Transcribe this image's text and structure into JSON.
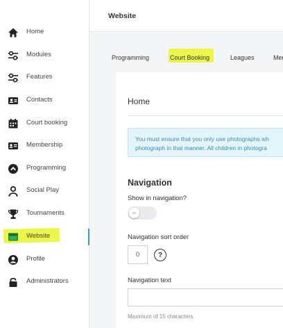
{
  "sidebar": {
    "items": [
      {
        "label": "Home",
        "icon": "home-icon"
      },
      {
        "label": "Modules",
        "icon": "sliders-icon"
      },
      {
        "label": "Features",
        "icon": "sliders-icon"
      },
      {
        "label": "Contacts",
        "icon": "contact-card-icon"
      },
      {
        "label": "Court booking",
        "icon": "calendar-icon"
      },
      {
        "label": "Membership",
        "icon": "id-card-icon"
      },
      {
        "label": "Programming",
        "icon": "chevron-circle-icon"
      },
      {
        "label": "Social Play",
        "icon": "user-group-icon"
      },
      {
        "label": "Tournaments",
        "icon": "trophy-icon"
      },
      {
        "label": "Website",
        "icon": "browser-icon",
        "active": true
      },
      {
        "label": "Profile",
        "icon": "user-circle-icon"
      },
      {
        "label": "Administrators",
        "icon": "lock-icon"
      }
    ],
    "active_color": "#2a9fd8",
    "highlight_color": "#ecf54a"
  },
  "header": {
    "title": "Website"
  },
  "tabs": [
    {
      "label": "Programming"
    },
    {
      "label": "Court Booking",
      "highlighted": true
    },
    {
      "label": "Leagues"
    },
    {
      "label": "Mer"
    }
  ],
  "page": {
    "title": "Home",
    "info_lines": [
      "You must ensure that you only use photographs wh",
      "photograph in that manner. All children in photogra"
    ],
    "section_title": "Navigation",
    "show_in_navigation": {
      "label": "Show in navigation?",
      "value": false
    },
    "sort_order": {
      "label": "Navigation sort order",
      "value": "0",
      "help": "?"
    },
    "nav_text": {
      "label": "Navigation text",
      "value": "",
      "hint": "Maximum of 15 characters"
    }
  }
}
